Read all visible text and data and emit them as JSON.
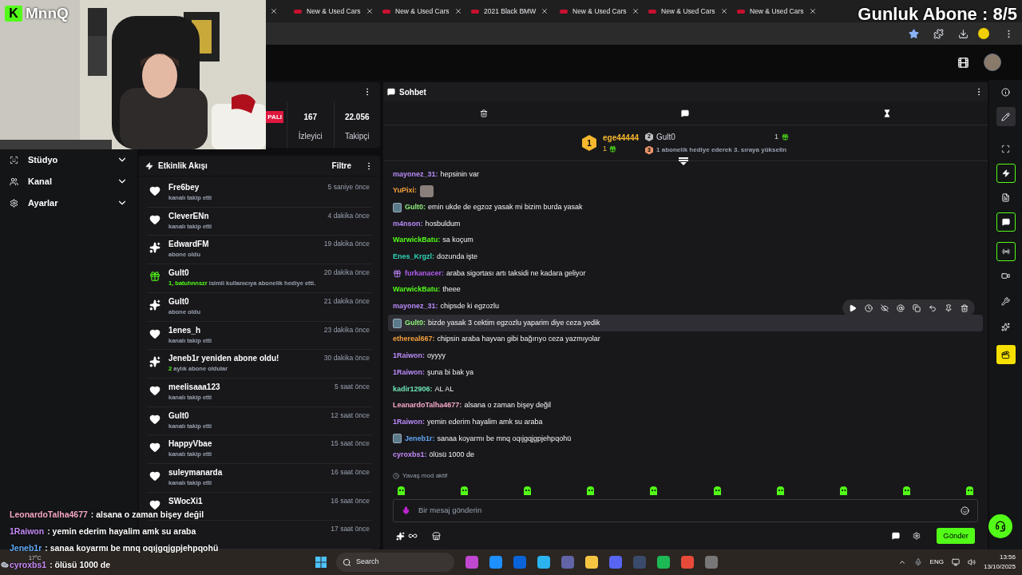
{
  "overlay": {
    "brand_mark": "K",
    "brand_name": "MnnQ",
    "counter": "Gunluk Abone : 8/5"
  },
  "browser": {
    "tabs": [
      {
        "title": "New & Used Cars"
      },
      {
        "title": "New & Used Cars"
      },
      {
        "title": "2021 Black BMW"
      },
      {
        "title": "New & Used Cars"
      },
      {
        "title": "New & Used Cars"
      },
      {
        "title": "New & Used Cars"
      }
    ]
  },
  "stats": {
    "status_badge": "PALI",
    "items": [
      {
        "value": "167",
        "label": "İzleyici"
      },
      {
        "value": "22.056",
        "label": "Takipçi"
      }
    ]
  },
  "sidebar": {
    "items": [
      {
        "label": "Stüdyo",
        "expanded": false
      },
      {
        "label": "Kanal",
        "expanded": false
      },
      {
        "label": "Ayarlar",
        "expanded": false
      }
    ]
  },
  "activity": {
    "title": "Etkinlik Akışı",
    "filter": "Filtre",
    "items": [
      {
        "kind": "follow",
        "name": "Fre6bey",
        "detail": "kanalı takip etti",
        "time": "5 saniye önce"
      },
      {
        "kind": "follow",
        "name": "CleverENn",
        "detail": "kanalı takip etti",
        "time": "4 dakika önce"
      },
      {
        "kind": "sub",
        "name": "EdwardFM",
        "detail": "abone oldu",
        "time": "19 dakika önce"
      },
      {
        "kind": "gift",
        "name": "Gult0",
        "highlight": "1, batuhnnszr",
        "detail": " isimli kullanıcıya abonelik hediye etti.",
        "time": "20 dakika önce"
      },
      {
        "kind": "sub",
        "name": "Gult0",
        "detail": "abone oldu",
        "time": "21 dakika önce"
      },
      {
        "kind": "follow",
        "name": "1enes_h",
        "detail": "kanalı takip etti",
        "time": "23 dakika önce"
      },
      {
        "kind": "sub",
        "name": "Jeneb1r yeniden abone oldu!",
        "highlight": "2",
        "detail": " aylık abone oldular",
        "time": "30 dakika önce"
      },
      {
        "kind": "follow",
        "name": "meelisaaa123",
        "detail": "kanalı takip etti",
        "time": "5 saat önce"
      },
      {
        "kind": "follow",
        "name": "Gult0",
        "detail": "kanalı takip etti",
        "time": "12 saat önce"
      },
      {
        "kind": "follow",
        "name": "HappyVbae",
        "detail": "kanalı takip etti",
        "time": "15 saat önce"
      },
      {
        "kind": "follow",
        "name": "suleymanarda",
        "detail": "kanalı takip etti",
        "time": "16 saat önce"
      },
      {
        "kind": "follow",
        "name": "SWocXi1",
        "time": "16 saat önce"
      },
      {
        "time": "17 saat önce"
      }
    ]
  },
  "chat": {
    "title": "Sohbet",
    "leaderboard": {
      "entries": [
        {
          "rank": "1",
          "name": "ege44444",
          "count": "1"
        },
        {
          "rank": "2",
          "name": "Gult0",
          "count": "1"
        }
      ],
      "hint": {
        "rank": "3",
        "text": "1 abonelik hediye ederek 3. sıraya yükselin"
      }
    },
    "messages": [
      {
        "kind": "text",
        "user": "mayonez_31:",
        "color": "#b98af7",
        "text": "hepsinin var",
        "subscriber": false,
        "gifter": false,
        "highlighted": false
      },
      {
        "kind": "emote",
        "user": "YuPixi:",
        "color": "#f5a13b",
        "subscriber": false,
        "gifter": false,
        "highlighted": false
      },
      {
        "kind": "text",
        "user": "Gult0:",
        "color": "#8ff27c",
        "text": "emin ukde de egzoz yasak mi bizim burda yasak",
        "subscriber": true,
        "gifter": false,
        "highlighted": false
      },
      {
        "kind": "text",
        "user": "m4nson:",
        "color": "#b98af7",
        "text": "hosbuldum",
        "subscriber": false,
        "gifter": false,
        "highlighted": false
      },
      {
        "kind": "text",
        "user": "WarwickBatu:",
        "color": "#53fc18",
        "text": "sa koçum",
        "subscriber": false,
        "gifter": false,
        "highlighted": false
      },
      {
        "kind": "text",
        "user": "Enes_Krgzl:",
        "color": "#2ed3b7",
        "text": "dozunda işte",
        "subscriber": false,
        "gifter": false,
        "highlighted": false
      },
      {
        "kind": "text",
        "user": "furkanacer:",
        "color": "#b25cf0",
        "text": "araba sigortası artı taksidi ne kadara geliyor",
        "subscriber": false,
        "gifter": true,
        "highlighted": false
      },
      {
        "kind": "text",
        "user": "WarwickBatu:",
        "color": "#53fc18",
        "text": "theee",
        "subscriber": false,
        "gifter": false,
        "highlighted": false
      },
      {
        "kind": "text",
        "user": "mayonez_31:",
        "color": "#b98af7",
        "text": "chipsde ki egzozlu",
        "subscriber": false,
        "gifter": false,
        "highlighted": false
      },
      {
        "kind": "text",
        "user": "Gult0:",
        "color": "#8ff27c",
        "text": "bizde yasak 3 cektim egzozlu yaparim diye ceza yedik",
        "subscriber": true,
        "gifter": false,
        "highlighted": true
      },
      {
        "kind": "text",
        "user": "ethereal667:",
        "color": "#f5a13b",
        "text": "chipsin araba hayvan gibi bağırıyo ceza yazmıyolar",
        "subscriber": false,
        "gifter": false,
        "highlighted": false
      },
      {
        "kind": "text",
        "user": "1Raiwon:",
        "color": "#b98af7",
        "text": "oyyyy",
        "subscriber": false,
        "gifter": false,
        "highlighted": false
      },
      {
        "kind": "text",
        "user": "1Raiwon:",
        "color": "#b98af7",
        "text": "şuna bi bak ya",
        "subscriber": false,
        "gifter": false,
        "highlighted": false
      },
      {
        "kind": "text",
        "user": "kadir12906:",
        "color": "#6ee7b7",
        "text": "AL AL",
        "subscriber": false,
        "gifter": false,
        "highlighted": false
      },
      {
        "kind": "text",
        "user": "LeanardoTalha4677:",
        "color": "#f7a8c8",
        "text": "alsana o zaman bişey değil",
        "subscriber": false,
        "gifter": false,
        "highlighted": false
      },
      {
        "kind": "text",
        "user": "1Raiwon:",
        "color": "#b98af7",
        "text": "yemin ederim hayalim amk su araba",
        "subscriber": false,
        "gifter": false,
        "highlighted": false
      },
      {
        "kind": "text",
        "user": "Jeneb1r:",
        "color": "#5fa8f5",
        "text": "sanaa koyarmı be mnq oqıjgqjgpjehpqohü",
        "subscriber": true,
        "gifter": false,
        "highlighted": false
      },
      {
        "kind": "text",
        "user": "cyroxbs1:",
        "color": "#c58af7",
        "text": "ölüsü 1000 de",
        "subscriber": false,
        "gifter": false,
        "highlighted": false
      }
    ],
    "slow_mode": "Yavaş mod aktif",
    "input": {
      "placeholder": "Bir mesaj gönderin"
    },
    "send": "Gönder"
  },
  "stream_overlay_chat": [
    {
      "user": "LeonardoTalha4677",
      "color": "#f7a8c8",
      "text": ": alsana o zaman bişey değil"
    },
    {
      "user": "1Raiwon",
      "color": "#c58af7",
      "text": ": yemin ederim hayalim amk su araba"
    },
    {
      "user": "Jeneb1r",
      "color": "#5fa8f5",
      "text": ": sanaa koyarmı be mnq oqıjgqjgpjehpqohü"
    },
    {
      "user": "cyroxbs1",
      "color": "#c58af7",
      "text": ": ölüsü 1000 de"
    }
  ],
  "taskbar": {
    "weather": "17°C",
    "search": "Search",
    "language": "ENG",
    "time": "13:56",
    "date": "13/10/2025"
  }
}
